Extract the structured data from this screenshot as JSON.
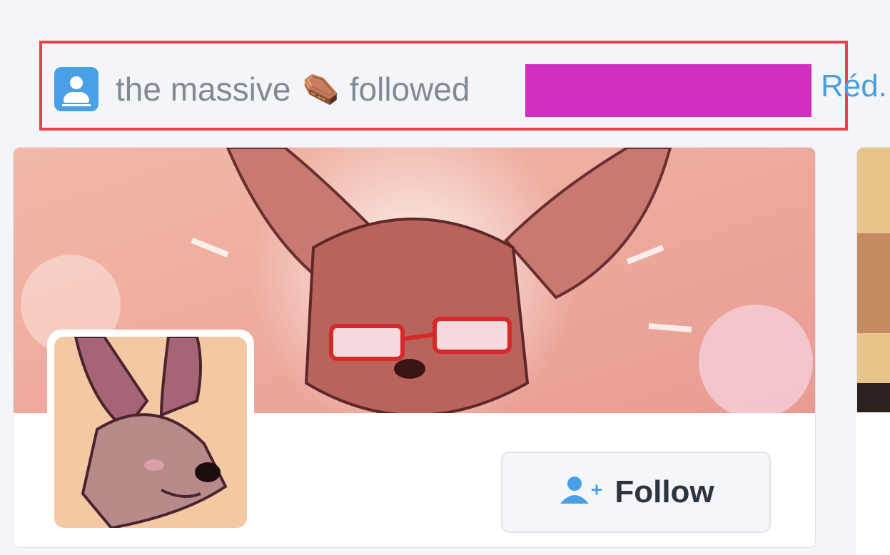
{
  "activity": {
    "actor_icon": "user-avatar-icon",
    "actor_name": "the massive",
    "actor_emoji": "⚰️",
    "verb": "followed",
    "target": "",
    "reply_link": "Réd..."
  },
  "profile_card": {
    "banner_image": "illustrated-fox-with-glasses",
    "avatar_image": "illustrated-fennec-character",
    "follow_button_label": "Follow",
    "follow_icon": "add-user-icon"
  },
  "colors": {
    "highlight_border": "#e3444b",
    "redaction": "#d02fbf",
    "link": "#4a9ee0",
    "icon_blue": "#4aa0e6"
  }
}
